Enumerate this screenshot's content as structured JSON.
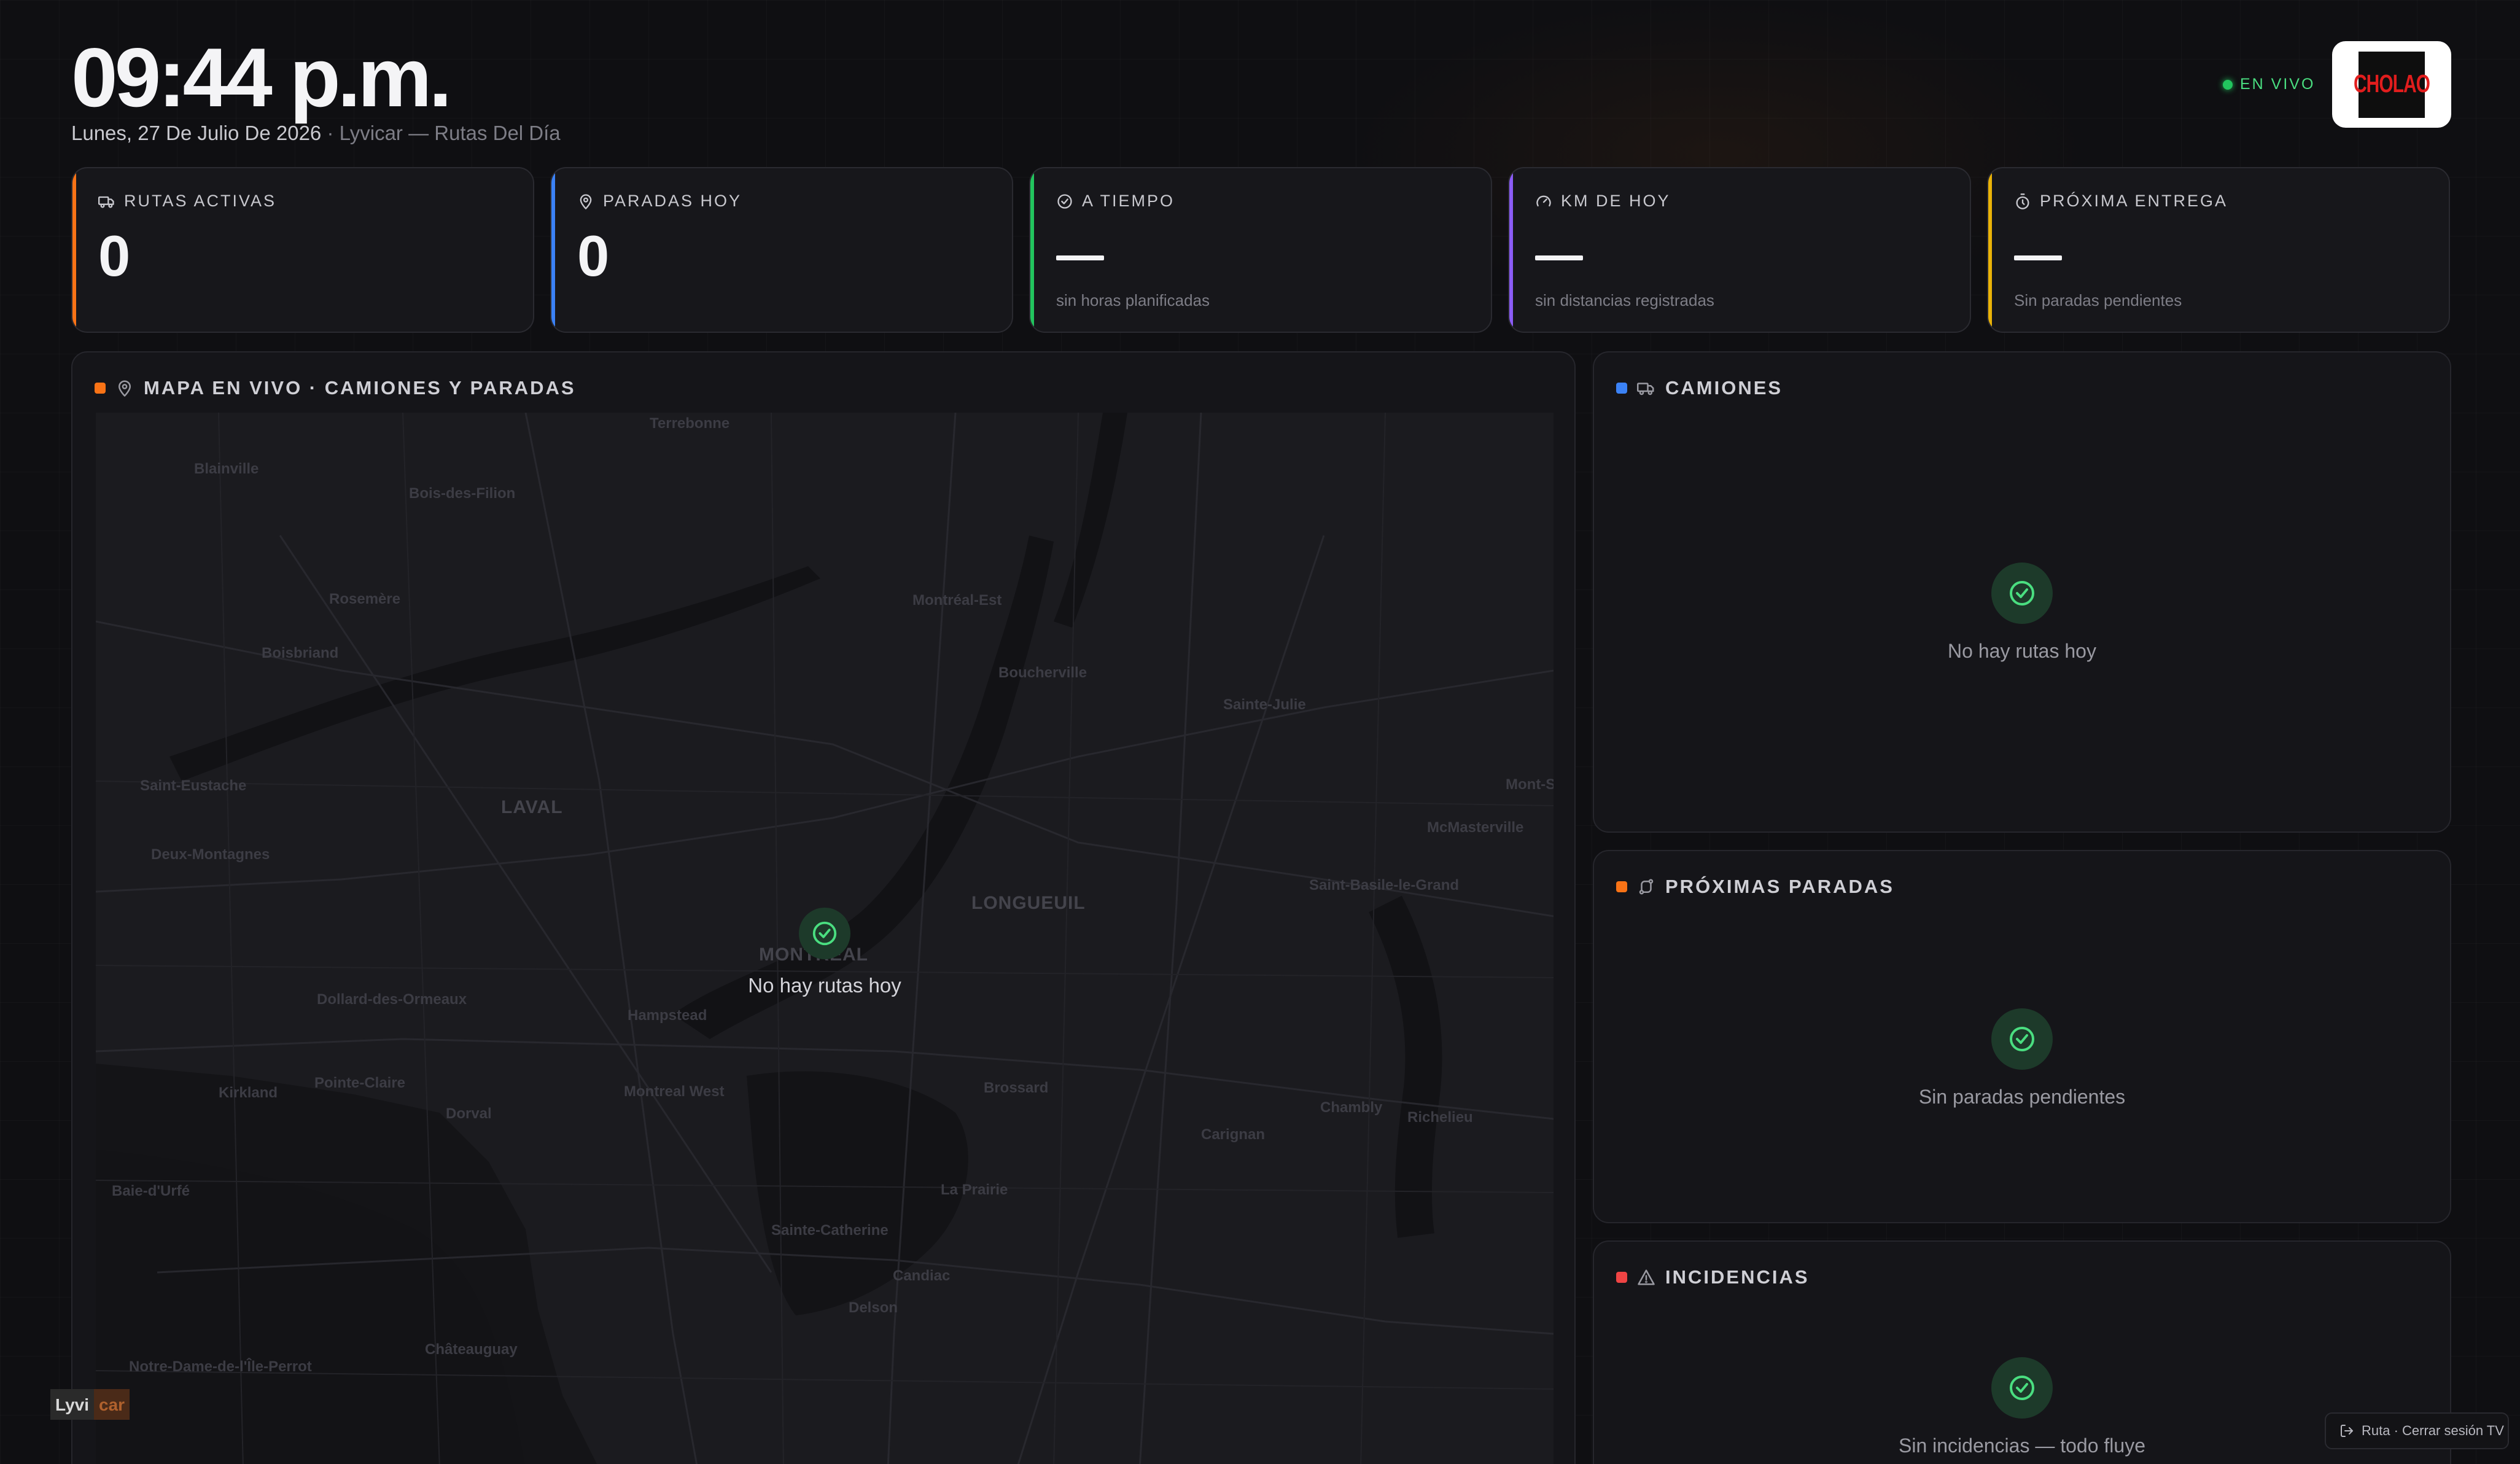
{
  "header": {
    "clock": "09:44 p.m.",
    "date": "Lunes, 27 De Julio De 2026",
    "context": " · Lyvicar — Rutas Del Día",
    "live_label": "EN VIVO",
    "logo_text": "CHOLAO"
  },
  "kpis": [
    {
      "label": "RUTAS ACTIVAS",
      "value": "0",
      "sub": "",
      "icon": "truck-icon",
      "accent": "#f97316"
    },
    {
      "label": "PARADAS HOY",
      "value": "0",
      "sub": "",
      "icon": "map-pin-icon",
      "accent": "#3b82f6"
    },
    {
      "label": "A TIEMPO",
      "value": "—",
      "sub": "sin horas planificadas",
      "icon": "check-circle-icon",
      "accent": "#22c55e"
    },
    {
      "label": "KM DE HOY",
      "value": "—",
      "sub": "sin distancias registradas",
      "icon": "gauge-icon",
      "accent": "#8b5cf6"
    },
    {
      "label": "PRÓXIMA ENTREGA",
      "value": "—",
      "sub": "Sin paradas pendientes",
      "icon": "timer-icon",
      "accent": "#eab308"
    }
  ],
  "map_panel": {
    "title": "MAPA EN VIVO · CAMIONES Y PARADAS",
    "empty_text": "No hay rutas hoy",
    "places": [
      "Terrebonne",
      "Blainville",
      "Bois-des-Filion",
      "Rosemère",
      "Boisbriand",
      "Montréal-Est",
      "Boucherville",
      "Sainte-Julie",
      "Saint-Eustache",
      "LAVAL",
      "Mont-St-Hilaire",
      "McMasterville",
      "Deux-Montagnes",
      "LONGUEUIL",
      "Saint-Basile-le-Grand",
      "MONTRÉAL",
      "Dollard-des-Ormeaux",
      "Hampstead",
      "Kirkland",
      "Pointe-Claire",
      "Dorval",
      "Montreal West",
      "Brossard",
      "Chambly",
      "Richelieu",
      "Carignan",
      "Baie-d'Urfé",
      "La Prairie",
      "Sainte-Catherine",
      "Candiac",
      "Delson",
      "Châteauguay",
      "Notre-Dame-de-l'Île-Perrot"
    ]
  },
  "trucks_panel": {
    "title": "CAMIONES",
    "empty_text": "No hay rutas hoy"
  },
  "stops_panel": {
    "title": "PRÓXIMAS PARADAS",
    "empty_text": "Sin paradas pendientes"
  },
  "incidents_panel": {
    "title": "INCIDENCIAS",
    "empty_text": "Sin incidencias — todo fluye"
  },
  "footer": {
    "brand_a": "Lyvi",
    "brand_b": "car",
    "logout_label": "Ruta · Cerrar sesión TV"
  },
  "colors": {
    "accent_orange": "#f97316",
    "accent_blue": "#3b82f6",
    "accent_green": "#22c55e",
    "accent_purple": "#8b5cf6",
    "accent_yellow": "#eab308",
    "accent_red": "#ef4444"
  }
}
